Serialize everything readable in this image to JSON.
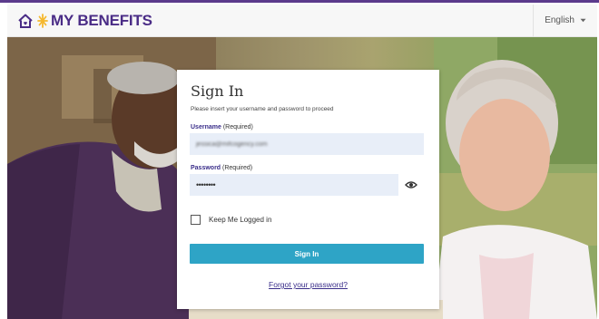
{
  "header": {
    "brand_text": "MY BENEFITS",
    "language": "English",
    "icons": [
      "home-icon",
      "star-burst-icon",
      "caret-down-icon"
    ]
  },
  "login": {
    "title": "Sign In",
    "subtitle": "Please insert your username and password to proceed",
    "username_label": "Username",
    "username_required": "(Required)",
    "username_value": "jessica@mifcogency.com",
    "password_label": "Password",
    "password_required": "(Required)",
    "password_value": "••••••••",
    "keep_logged_in": "Keep Me Logged in",
    "submit": "Sign In",
    "forgot": "Forgot your password?"
  },
  "colors": {
    "brand_purple": "#4a2c86",
    "top_line": "#5b3a8c",
    "button": "#2ea4c6",
    "input_bg": "#e8eef8"
  }
}
